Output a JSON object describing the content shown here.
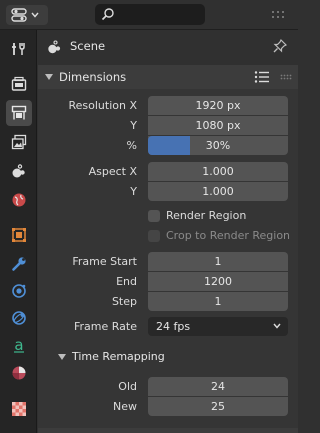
{
  "header": {
    "editor_type_icon": "properties-editor-icon",
    "search": {
      "value": "",
      "placeholder": ""
    }
  },
  "tabs": [
    {
      "icon": "tool-icon"
    },
    {
      "icon": "render-icon"
    },
    {
      "icon": "output-icon",
      "active": true
    },
    {
      "icon": "view-layer-icon"
    },
    {
      "icon": "scene-icon"
    },
    {
      "icon": "world-icon"
    },
    {
      "icon": "object-icon"
    },
    {
      "icon": "modifier-icon"
    },
    {
      "icon": "particles-icon"
    },
    {
      "icon": "physics-icon"
    },
    {
      "icon": "constraints-icon"
    },
    {
      "icon": "data-icon"
    },
    {
      "icon": "material-icon"
    },
    {
      "icon": "texture-icon"
    }
  ],
  "context": {
    "name": "Scene"
  },
  "dimensions": {
    "title": "Dimensions",
    "resolution_x_label": "Resolution X",
    "resolution_x": "1920 px",
    "resolution_y_label": "Y",
    "resolution_y": "1080 px",
    "percent_label": "%",
    "percent_value": "30%",
    "percent_fraction": 0.3,
    "aspect_x_label": "Aspect X",
    "aspect_x": "1.000",
    "aspect_y_label": "Y",
    "aspect_y": "1.000",
    "render_region_label": "Render Region",
    "render_region_checked": false,
    "crop_label": "Crop to Render Region",
    "crop_checked": false,
    "frame_start_label": "Frame Start",
    "frame_start": "1",
    "frame_end_label": "End",
    "frame_end": "1200",
    "frame_step_label": "Step",
    "frame_step": "1",
    "frame_rate_label": "Frame Rate",
    "frame_rate": "24 fps"
  },
  "time_remapping": {
    "title": "Time Remapping",
    "old_label": "Old",
    "old": "24",
    "new_label": "New",
    "new": "25"
  },
  "colors": {
    "accent": "#4772b3",
    "field": "#545454",
    "panel": "#353535",
    "background": "#303030"
  }
}
